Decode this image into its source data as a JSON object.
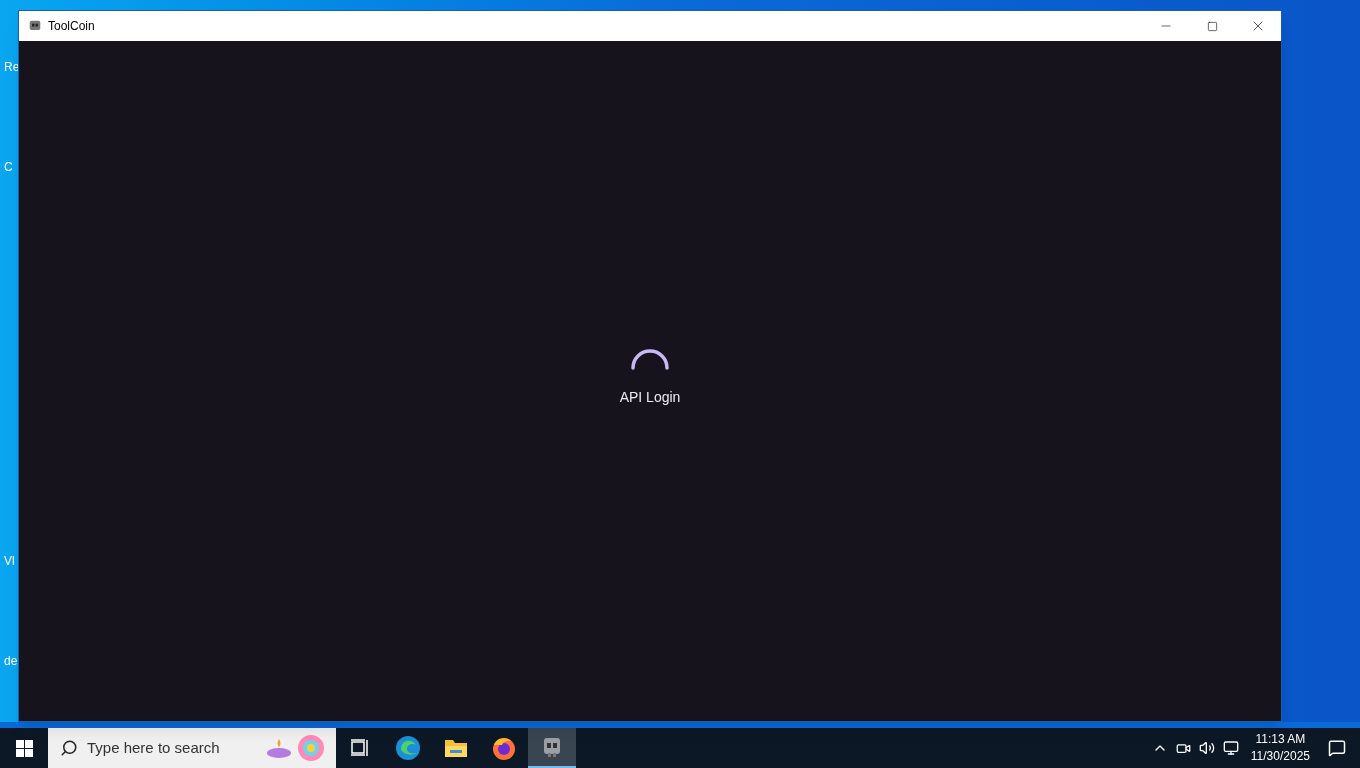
{
  "desktop": {
    "icons": [
      {
        "label": "Re"
      },
      {
        "label": "C"
      },
      {
        "label": "Vl"
      },
      {
        "label": "de"
      }
    ]
  },
  "window": {
    "title": "ToolCoin",
    "loading": {
      "text": "API Login"
    }
  },
  "taskbar": {
    "search": {
      "placeholder": "Type here to search"
    },
    "apps": [
      {
        "kind": "taskview",
        "selected": false
      },
      {
        "kind": "edge",
        "selected": false
      },
      {
        "kind": "explorer",
        "selected": false
      },
      {
        "kind": "firefox",
        "selected": false
      },
      {
        "kind": "toolcoin",
        "selected": true
      }
    ],
    "clock": {
      "time": "11:13 AM",
      "date": "11/30/2025"
    }
  }
}
